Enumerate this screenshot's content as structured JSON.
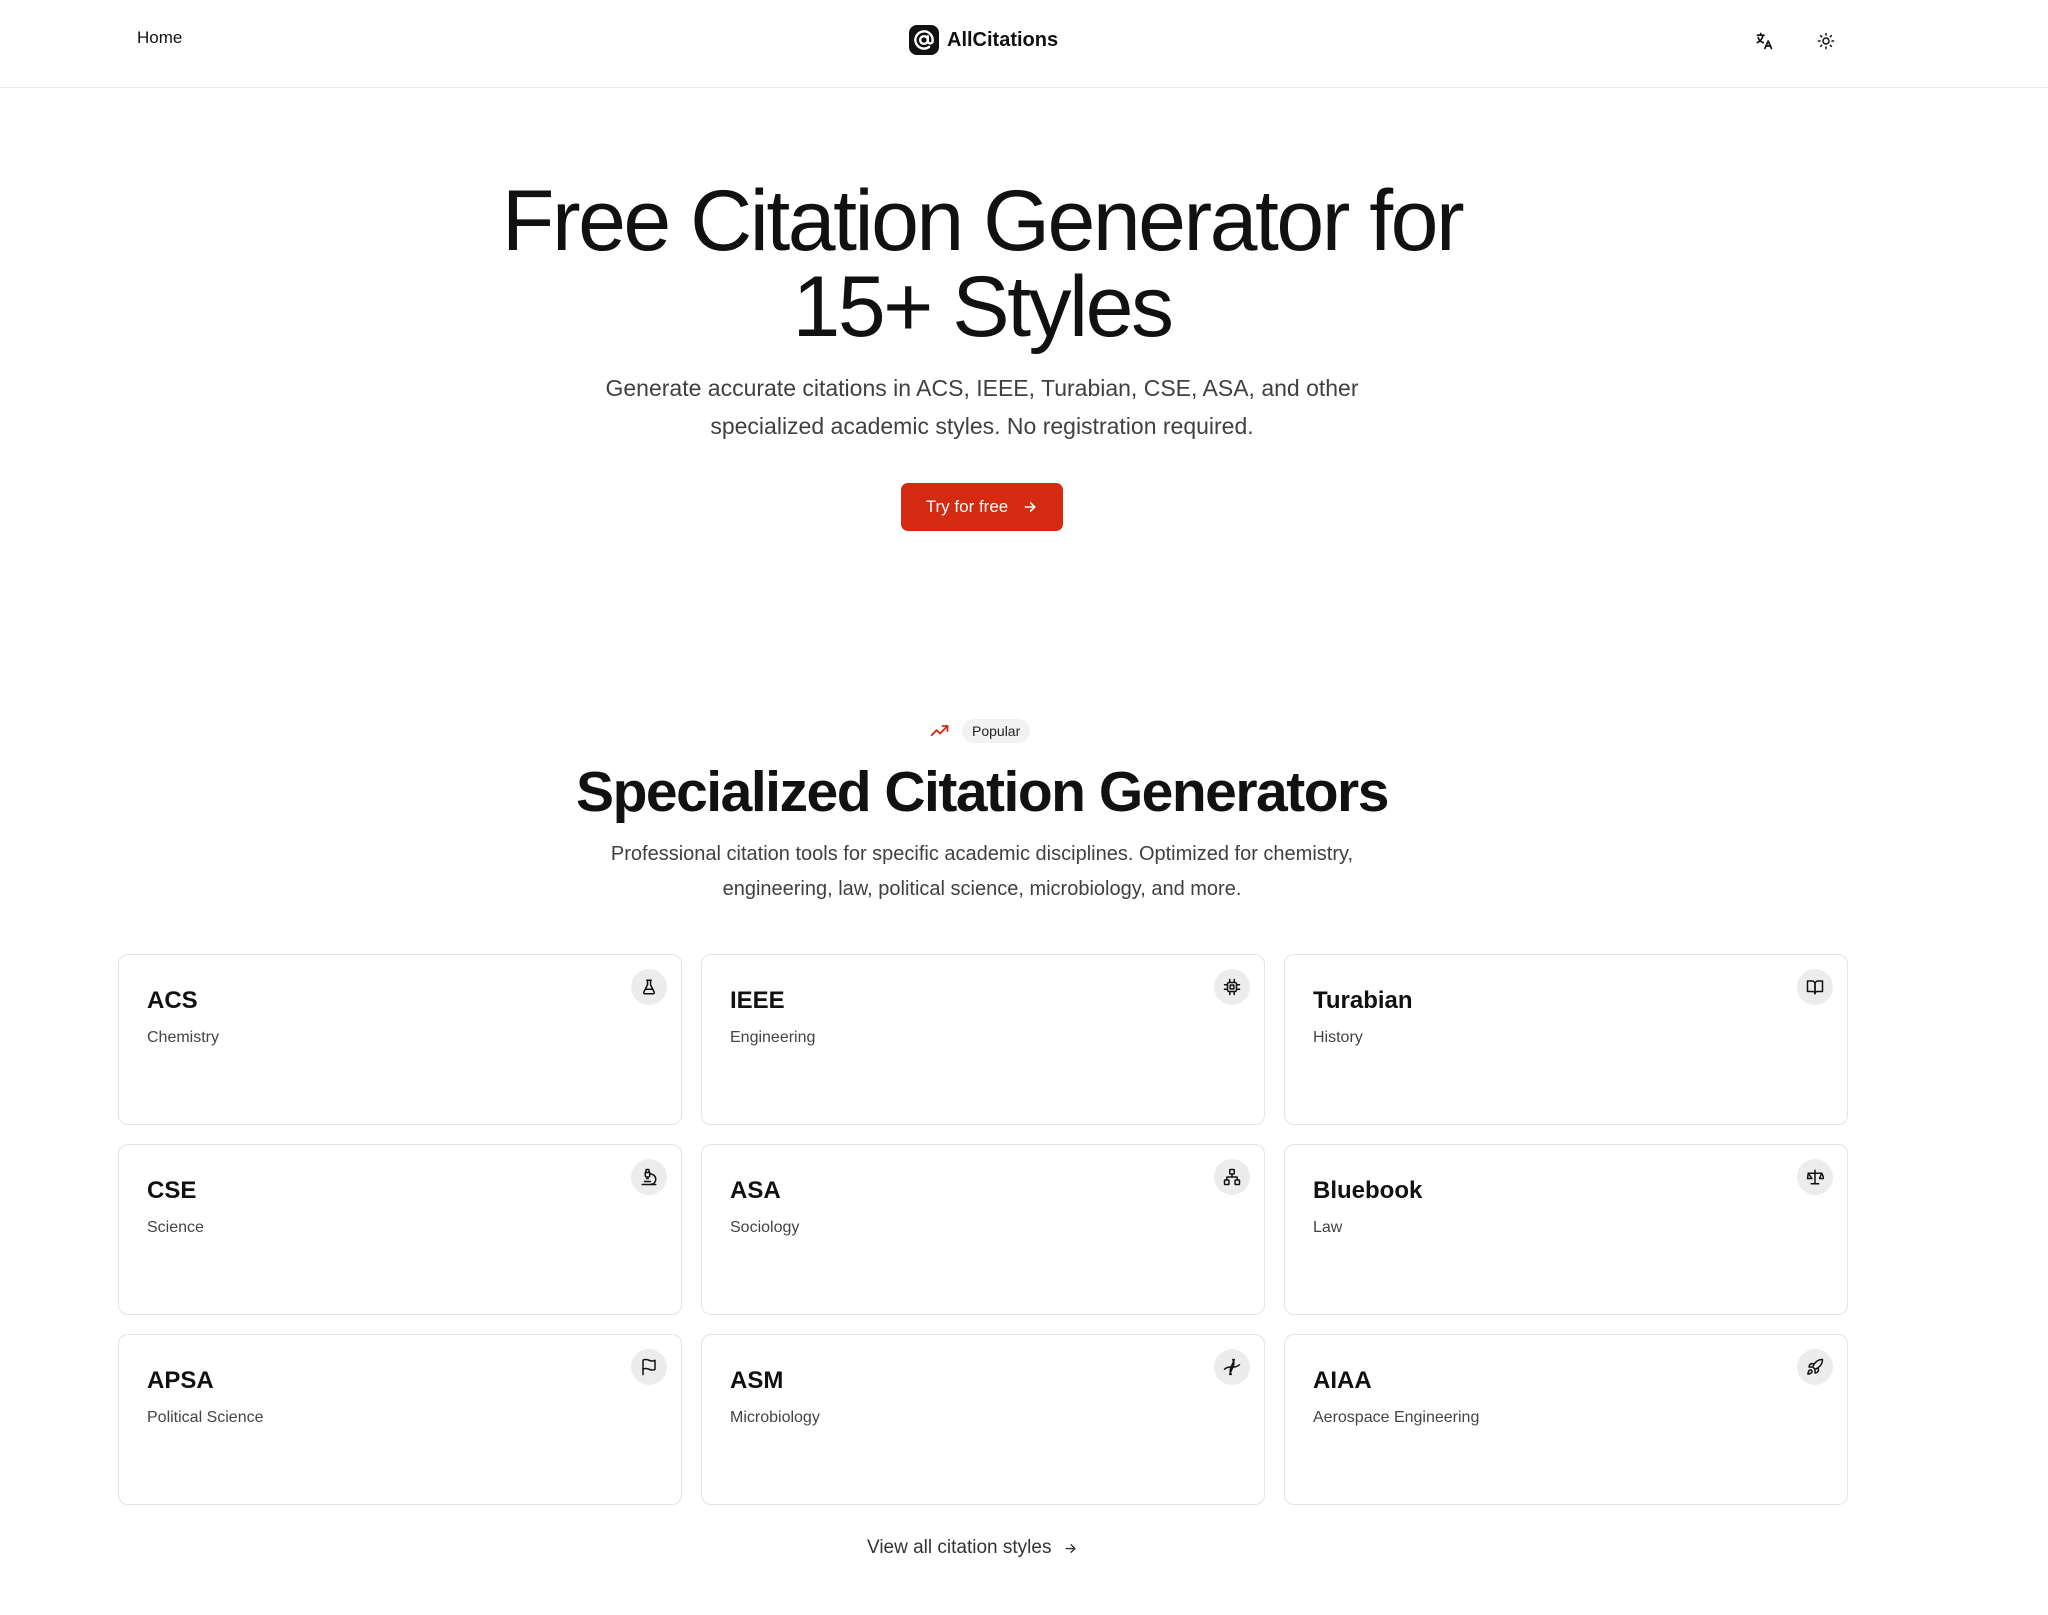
{
  "header": {
    "nav_home": "Home",
    "brand_name": "AllCitations",
    "icons": {
      "language": "translate-icon",
      "theme": "sun-icon",
      "logo": "at-sign-logo"
    }
  },
  "hero": {
    "title_line1": "Free Citation Generator for",
    "title_line2": "15+ Styles",
    "subtitle_line1": "Generate accurate citations in ACS, IEEE, Turabian, CSE, ASA, and other",
    "subtitle_line2": "specialized academic styles. No registration required.",
    "cta_label": "Try for free",
    "cta_color": "#d42a11"
  },
  "section": {
    "badge_label": "Popular",
    "badge_icon": "trending-up-icon",
    "title": "Specialized Citation Generators",
    "subtitle_line1": "Professional citation tools for specific academic disciplines. Optimized for chemistry,",
    "subtitle_line2": "engineering, law, political science, microbiology, and more.",
    "view_all_label": "View all citation styles"
  },
  "cards": [
    {
      "title": "ACS",
      "subtitle": "Chemistry",
      "icon": "flask-icon"
    },
    {
      "title": "IEEE",
      "subtitle": "Engineering",
      "icon": "cpu-icon"
    },
    {
      "title": "Turabian",
      "subtitle": "History",
      "icon": "book-open-icon"
    },
    {
      "title": "CSE",
      "subtitle": "Science",
      "icon": "microscope-icon"
    },
    {
      "title": "ASA",
      "subtitle": "Sociology",
      "icon": "network-icon"
    },
    {
      "title": "Bluebook",
      "subtitle": "Law",
      "icon": "scale-icon"
    },
    {
      "title": "APSA",
      "subtitle": "Political Science",
      "icon": "flag-icon"
    },
    {
      "title": "ASM",
      "subtitle": "Microbiology",
      "icon": "dna-icon"
    },
    {
      "title": "AIAA",
      "subtitle": "Aerospace Engineering",
      "icon": "rocket-icon"
    }
  ]
}
